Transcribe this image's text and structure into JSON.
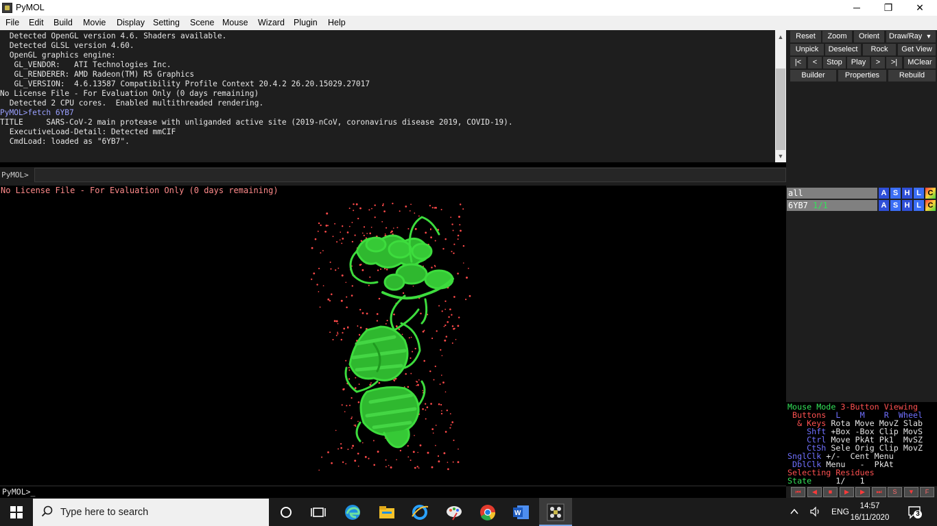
{
  "window": {
    "title": "PyMOL",
    "minimize": "─",
    "maximize": "❐",
    "close": "✕"
  },
  "menu": [
    "File",
    "Edit",
    "Build",
    "Movie",
    "Display",
    "Setting",
    "Scene",
    "Mouse",
    "Wizard",
    "Plugin",
    "Help"
  ],
  "console": {
    "lines": [
      {
        "text": " Detected OpenGL version 4.6. Shaders available.",
        "color": "#e6e6e6"
      },
      {
        "text": " Detected GLSL version 4.60.",
        "color": "#e6e6e6"
      },
      {
        "text": " OpenGL graphics engine:",
        "color": "#e6e6e6"
      },
      {
        "text": "  GL_VENDOR:   ATI Technologies Inc.",
        "color": "#e6e6e6"
      },
      {
        "text": "  GL_RENDERER: AMD Radeon(TM) R5 Graphics",
        "color": "#e6e6e6"
      },
      {
        "text": "  GL_VERSION:  4.6.13587 Compatibility Profile Context 20.4.2 26.20.15029.27017",
        "color": "#e6e6e6"
      },
      {
        "text": "No License File - For Evaluation Only (0 days remaining)",
        "color": "#e6e6e6"
      },
      {
        "text": " Detected 2 CPU cores.  Enabled multithreaded rendering.",
        "color": "#e6e6e6"
      },
      {
        "text": "PyMOL>fetch 6YB7",
        "color": "#9aa0ff"
      },
      {
        "text": "TITLE     SARS-CoV-2 main protease with unliganded active site (2019-nCoV, coronavirus disease 2019, COVID-19).",
        "color": "#e6e6e6"
      },
      {
        "text": " ExecutiveLoad-Detail: Detected mmCIF",
        "color": "#e6e6e6"
      },
      {
        "text": " CmdLoad: loaded as \"6YB7\".",
        "color": "#e6e6e6"
      }
    ]
  },
  "command": {
    "label": "PyMOL>",
    "value": ""
  },
  "buttons": {
    "row1": [
      "Reset",
      "Zoom",
      "Orient",
      "Draw/Ray"
    ],
    "draw_arrow": "▼",
    "row2": [
      "Unpick",
      "Deselect",
      "Rock",
      "Get View"
    ],
    "row3": [
      "|<",
      "<",
      "Stop",
      "Play",
      ">",
      ">|",
      "MClear"
    ],
    "row4": [
      "Builder",
      "Properties",
      "Rebuild"
    ]
  },
  "viewport": {
    "license_text": "No License File - For Evaluation Only (0 days remaining)",
    "bottom_prompt": "PyMOL>_",
    "cartoon_color": "#3ddc3d",
    "water_color": "#ff4040"
  },
  "objects": [
    {
      "name": "all",
      "state": ""
    },
    {
      "name": "6YB7",
      "state": "1/1"
    }
  ],
  "obj_buttons": [
    "A",
    "S",
    "H",
    "L",
    "C"
  ],
  "mouse_panel": {
    "mode_prefix": "Mouse Mode ",
    "mode_name": "3-Button Viewing",
    "buttons_row": {
      "label": " Buttons",
      "l": "  L",
      "m": "    M",
      "r": "    R",
      "wheel": "  Wheel"
    },
    "rows": [
      {
        "label": "  & Keys",
        "values": " Rota Move MovZ Slab"
      },
      {
        "label": "    Shft",
        "values": " +Box -Box Clip MovS"
      },
      {
        "label": "    Ctrl",
        "values": " Move PkAt Pk1  MvSZ"
      },
      {
        "label": "    CtSh",
        "values": " Sele Orig Clip MovZ"
      },
      {
        "label": "SnglClk",
        "values": " +/-  Cent Menu"
      },
      {
        "label": " DblClk",
        "values": " Menu   -  PkAt"
      }
    ],
    "selecting": "Selecting Residues",
    "state_label": "State",
    "state_value": "     1/   1"
  },
  "player": [
    "⏮",
    "◀",
    "■",
    "▶",
    "▶",
    "⏭",
    "S",
    "▼",
    "F"
  ],
  "taskbar": {
    "search_placeholder": "Type here to search",
    "language": "ENG",
    "time": "14:57",
    "date": "16/11/2020",
    "notifications": "3",
    "icons": [
      "windows-start-icon",
      "search-icon",
      "cortana-icon",
      "task-view-icon",
      "edge-icon",
      "file-explorer-icon",
      "internet-explorer-icon",
      "paint-icon",
      "chrome-icon",
      "word-icon",
      "pymol-icon",
      "chevron-up-icon",
      "speaker-icon",
      "notification-icon"
    ]
  }
}
